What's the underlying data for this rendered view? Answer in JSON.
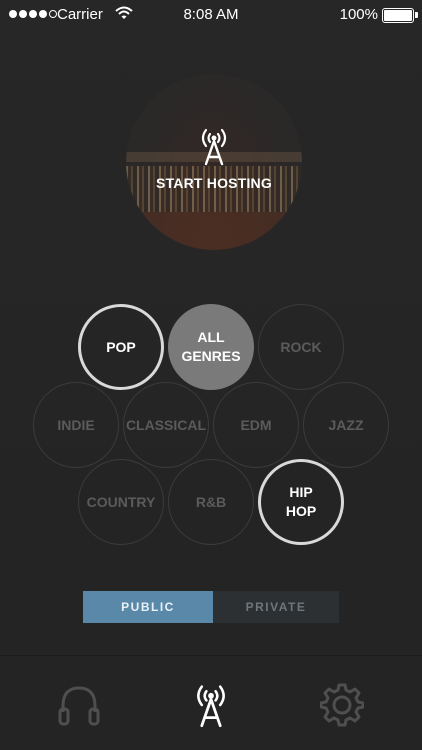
{
  "status_bar": {
    "carrier": "Carrier",
    "time": "8:08 AM",
    "battery": "100%"
  },
  "host": {
    "label": "START HOSTING",
    "icon": "broadcast-tower-icon"
  },
  "genres": [
    {
      "id": "pop",
      "label": "POP",
      "state": "selected"
    },
    {
      "id": "all-genres",
      "label": "ALL GENRES",
      "state": "active"
    },
    {
      "id": "rock",
      "label": "ROCK",
      "state": "inactive"
    },
    {
      "id": "indie",
      "label": "INDIE",
      "state": "inactive"
    },
    {
      "id": "classical",
      "label": "CLASSICAL",
      "state": "inactive"
    },
    {
      "id": "edm",
      "label": "EDM",
      "state": "inactive"
    },
    {
      "id": "jazz",
      "label": "JAZZ",
      "state": "inactive"
    },
    {
      "id": "country",
      "label": "COUNTRY",
      "state": "inactive"
    },
    {
      "id": "rnb",
      "label": "R&B",
      "state": "inactive"
    },
    {
      "id": "hip-hop",
      "label": "HIP HOP",
      "state": "selected"
    }
  ],
  "visibility": {
    "options": [
      "PUBLIC",
      "PRIVATE"
    ],
    "selected": "PUBLIC"
  },
  "tabbar": {
    "items": [
      {
        "icon": "headphones-icon",
        "active": false
      },
      {
        "icon": "broadcast-tower-icon",
        "active": true
      },
      {
        "icon": "gear-icon",
        "active": false
      }
    ]
  },
  "colors": {
    "background": "#262626",
    "accent_public": "#5a88a8",
    "selected_ring": "#d9d9d9",
    "all_genres_fill": "#7a7a7a",
    "inactive_text": "#5b5b5b"
  }
}
